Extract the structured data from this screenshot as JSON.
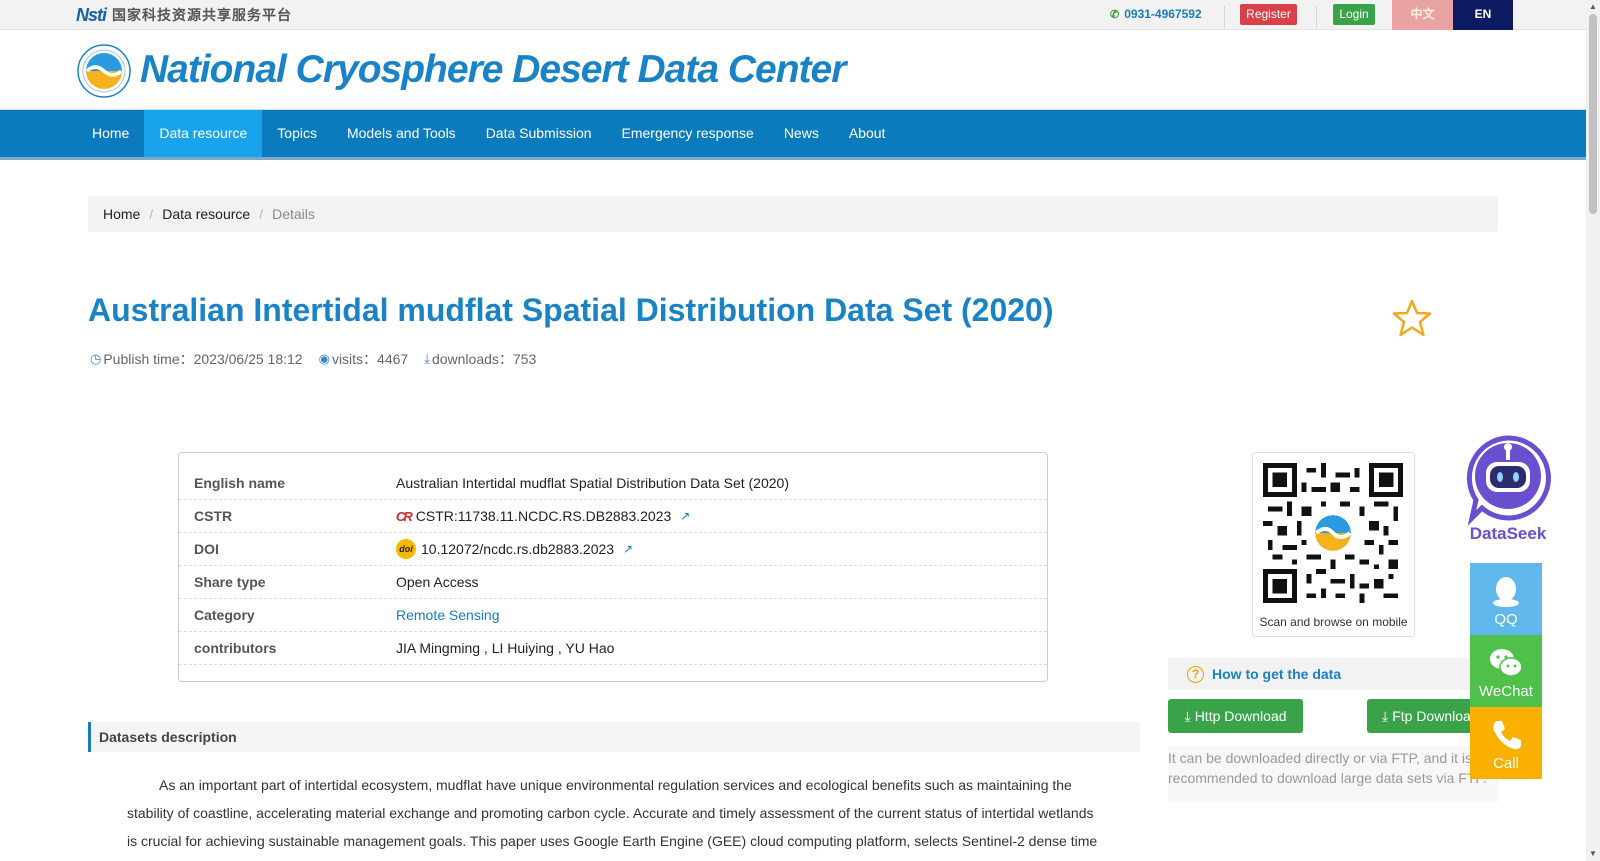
{
  "topbar": {
    "nsti_logo": "Nsti",
    "platform_name": "国家科技资源共享服务平台",
    "phone": "0931-4967592",
    "register_label": "Register",
    "login_label": "Login",
    "lang_zh": "中文",
    "lang_en": "EN"
  },
  "header": {
    "site_title": "National Cryosphere Desert Data Center"
  },
  "nav": {
    "items": [
      {
        "label": "Home"
      },
      {
        "label": "Data resource",
        "active": true
      },
      {
        "label": "Topics"
      },
      {
        "label": "Models and Tools"
      },
      {
        "label": "Data Submission"
      },
      {
        "label": "Emergency response"
      },
      {
        "label": "News"
      },
      {
        "label": "About"
      }
    ]
  },
  "breadcrumb": [
    "Home",
    "Data resource",
    "Details"
  ],
  "dataset": {
    "title": "Australian Intertidal mudflat Spatial Distribution Data Set (2020)",
    "publish": "Publish time：2023/06/25 18:12",
    "visits": "visits：4467",
    "downloads": "downloads：753"
  },
  "info": {
    "rows": [
      {
        "label": "English name",
        "value": "Australian Intertidal mudflat Spatial Distribution Data Set (2020)"
      },
      {
        "label": "CSTR",
        "value": "CSTR:11738.11.NCDC.RS.DB2883.2023"
      },
      {
        "label": "DOI",
        "value": "10.12072/ncdc.rs.db2883.2023"
      },
      {
        "label": "Share type",
        "value": "Open Access"
      },
      {
        "label": "Category",
        "value": "Remote Sensing"
      },
      {
        "label": "contributors",
        "value": "JIA Mingming , LI Huiying , YU Hao"
      }
    ]
  },
  "qr": {
    "caption": "Scan and browse on mobile"
  },
  "download": {
    "howto_label": "How to get the data",
    "http_label": "Http Download",
    "ftp_label": "Ftp Download",
    "note": "It can be downloaded directly or via FTP, and it is recommended to download large data sets via FTP."
  },
  "description": {
    "heading": "Datasets description",
    "text": "As an important part of intertidal ecosystem, mudflat have unique environmental regulation services and ecological benefits such as maintaining the stability of coastline, accelerating material exchange and promoting carbon cycle. Accurate and timely assessment of the current status of intertidal wetlands is crucial for achieving sustainable management goals. This paper uses Google Earth Engine (GEE) cloud computing platform, selects Sentinel-2 dense time"
  },
  "side": {
    "dataseek": "DataSeek",
    "qq": "QQ",
    "wechat": "WeChat",
    "call": "Call"
  },
  "colors": {
    "brand_blue": "#1a82c7",
    "nav_bg": "#0c7bbd",
    "nav_active": "#18a3ec",
    "register_red": "#d9414a",
    "green": "#3aa34a",
    "en_navy": "#0d1b63"
  },
  "icons": [
    "phone-icon",
    "clock-icon",
    "eye-icon",
    "download-icon",
    "external-link-icon",
    "cstr-icon",
    "doi-icon",
    "star-icon",
    "question-circle-icon",
    "qq-icon",
    "wechat-icon",
    "phone-call-icon",
    "robot-icon"
  ]
}
